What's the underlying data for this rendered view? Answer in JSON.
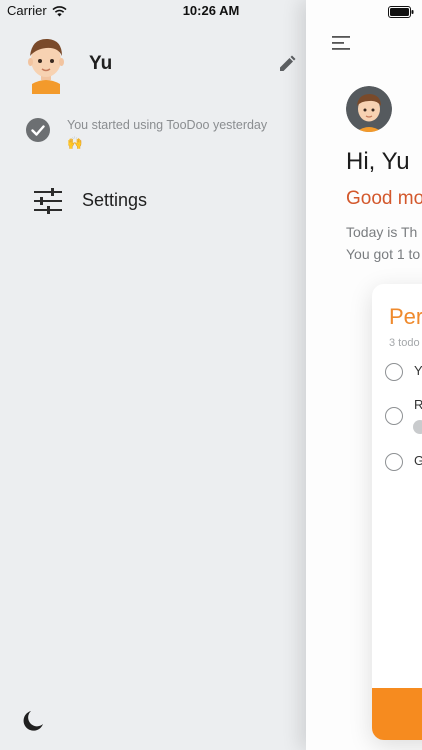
{
  "status_bar": {
    "carrier": "Carrier",
    "time": "10:26 AM"
  },
  "drawer": {
    "username": "Yu",
    "started_text": "You started using TooDoo yesterday",
    "started_emoji": "🙌",
    "settings_label": "Settings"
  },
  "main": {
    "greeting": "Hi, Yu",
    "good_morning": "Good mo",
    "today_line": "Today is Th",
    "todo_line": "You got 1 to",
    "card": {
      "title": "Per",
      "count_text": "3 todo",
      "tasks": [
        {
          "label": "Y"
        },
        {
          "label": "R"
        },
        {
          "label": "G"
        }
      ]
    }
  },
  "colors": {
    "accent_orange": "#f68b1f",
    "greeting_red": "#d3582c",
    "card_title_orange": "#ef8a2d",
    "drawer_bg": "#eceef0"
  },
  "icons": {
    "wifi": "wifi-icon",
    "battery": "battery-icon",
    "edit": "pencil-icon",
    "check": "check-circle-icon",
    "settings": "sliders-icon",
    "moon": "moon-icon",
    "menu": "hamburger-menu-icon"
  }
}
